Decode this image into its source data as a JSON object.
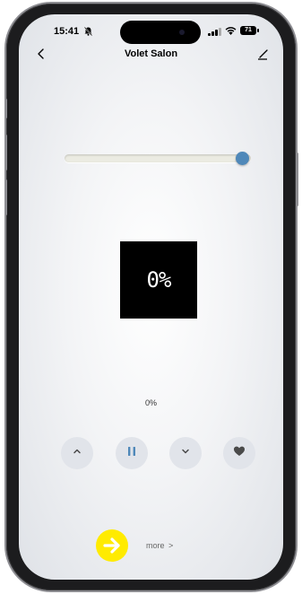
{
  "status_bar": {
    "time": "15:41",
    "battery": "71"
  },
  "header": {
    "title": "Volet Salon"
  },
  "slider": {
    "position": 1.0
  },
  "display": {
    "position_label": "0%"
  },
  "position_text": "0%",
  "controls": [
    {
      "name": "open-button",
      "icon": "chevron-up-icon"
    },
    {
      "name": "pause-button",
      "icon": "pause-icon"
    },
    {
      "name": "close-button",
      "icon": "chevron-down-icon"
    },
    {
      "name": "favorite-button",
      "icon": "heart-icon"
    }
  ],
  "footer": {
    "more_label": "more",
    "more_chevron": ">"
  },
  "colors": {
    "accent": "#4f88b9",
    "highlight": "#ffeb00",
    "display_bg": "#000000"
  }
}
